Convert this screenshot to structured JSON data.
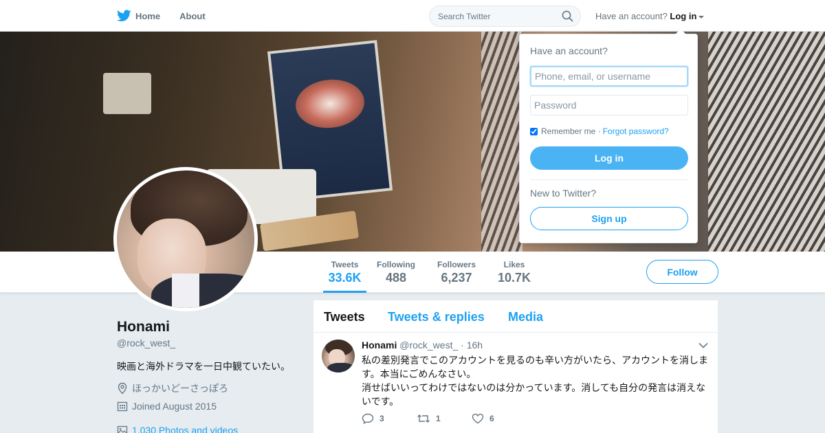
{
  "topbar": {
    "nav": [
      {
        "label": "Home",
        "icon": "twitter-bird-icon"
      },
      {
        "label": "About"
      }
    ],
    "search_placeholder": "Search Twitter",
    "account_prompt": "Have an account?",
    "login_label": "Log in"
  },
  "profile_nav": {
    "stats": [
      {
        "label": "Tweets",
        "value": "33.6K",
        "active": true
      },
      {
        "label": "Following",
        "value": "488"
      },
      {
        "label": "Followers",
        "value": "6,237"
      },
      {
        "label": "Likes",
        "value": "10.7K"
      }
    ],
    "follow_label": "Follow"
  },
  "profile": {
    "name": "Honami",
    "handle": "@rock_west_",
    "bio": "映画と海外ドラマを一日中観ていたい。",
    "location": "ほっかいどーさっぽろ",
    "joined": "Joined August 2015",
    "photos": "1,030 Photos and videos"
  },
  "timeline": {
    "tabs": [
      {
        "label": "Tweets",
        "active": true
      },
      {
        "label": "Tweets & replies"
      },
      {
        "label": "Media"
      }
    ],
    "tweets": [
      {
        "name": "Honami",
        "handle": "@rock_west_",
        "time": "· 16h",
        "text": "私の差別発言でこのアカウントを見るのも辛い方がいたら、アカウントを消します。本当にごめんなさい。\n消せばいいってわけではないのは分かっています。消しても自分の発言は消えないです。",
        "replies": "3",
        "retweets": "1",
        "likes": "6"
      }
    ]
  },
  "login_dropdown": {
    "title": "Have an account?",
    "username_placeholder": "Phone, email, or username",
    "password_placeholder": "Password",
    "remember_label": "Remember me ·",
    "forgot_label": "Forgot password?",
    "login_button": "Log in",
    "new_prompt": "New to Twitter?",
    "signup_button": "Sign up"
  },
  "colors": {
    "accent": "#1da1f2",
    "login_button": "#4ab3f4",
    "background": "#e6ecf0"
  }
}
